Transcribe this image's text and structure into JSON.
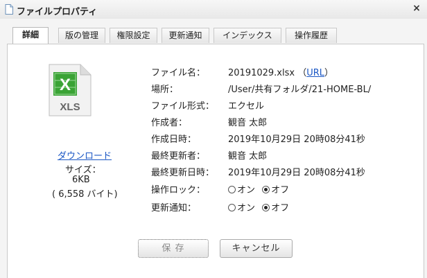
{
  "titlebar": {
    "title": "ファイルプロパティ",
    "close_label": "×"
  },
  "tabs": [
    {
      "label": "詳細",
      "active": true
    },
    {
      "label": "版の管理",
      "active": false
    },
    {
      "label": "権限設定",
      "active": false
    },
    {
      "label": "更新通知",
      "active": false
    },
    {
      "label": "インデックス",
      "active": false
    },
    {
      "label": "操作履歴",
      "active": false
    }
  ],
  "file": {
    "icon_letter": "X",
    "icon_ext": "XLS",
    "download_label": "ダウンロード",
    "size_label": "サイズ：",
    "size_value": "6KB",
    "size_bytes": "( 6,558 バイト)"
  },
  "properties": {
    "filename_label": "ファイル名：",
    "filename_value": "20191029.xlsx",
    "url_open": "（",
    "url_label": "URL",
    "url_close": "）",
    "location_label": "場所：",
    "location_value": "/User/共有フォルダ/21-HOME-BL/",
    "format_label": "ファイル形式：",
    "format_value": "エクセル",
    "creator_label": "作成者：",
    "creator_value": "観音 太郎",
    "created_label": "作成日時：",
    "created_value": "2019年10月29日 20時08分41秒",
    "updater_label": "最終更新者：",
    "updater_value": "観音 太郎",
    "updated_label": "最終更新日時：",
    "updated_value": "2019年10月29日 20時08分41秒",
    "lock_label": "操作ロック：",
    "notify_label": "更新通知：",
    "on_label": "オン",
    "off_label": "オフ"
  },
  "settings": {
    "lock_selected": "オフ",
    "notify_selected": "オフ"
  },
  "buttons": {
    "save_label": "保 存",
    "cancel_label": "キャンセル"
  },
  "colors": {
    "excel_green": "#3aa335",
    "link_blue": "#1a56c4"
  }
}
